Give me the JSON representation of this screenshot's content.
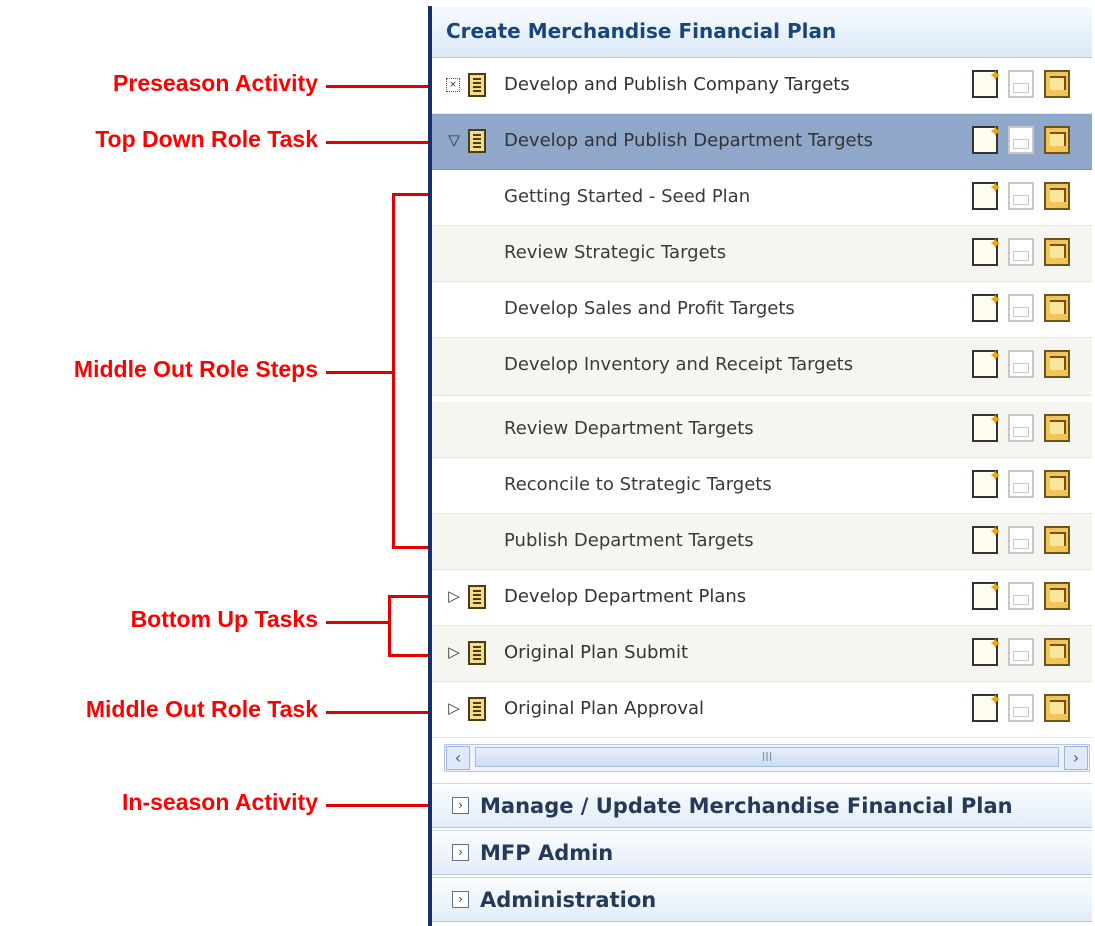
{
  "callouts": {
    "preseason": "Preseason Activity",
    "top_down": "Top Down Role Task",
    "middle_steps": "Middle Out Role Steps",
    "bottom_up": "Bottom Up Tasks",
    "middle_task": "Middle Out Role Task",
    "inseason": "In-season Activity"
  },
  "panel": {
    "title": "Create Merchandise Financial Plan",
    "tasks": [
      {
        "label": "Develop and Publish Company Targets",
        "expander": "⊠"
      },
      {
        "label": "Develop and Publish Department Targets",
        "expander": "▽"
      }
    ],
    "steps": [
      "Getting Started - Seed Plan",
      "Review Strategic Targets",
      "Develop Sales and Profit Targets",
      "Develop Inventory and Receipt Targets",
      "Review Department Targets",
      "Reconcile to Strategic Targets",
      "Publish Department Targets"
    ],
    "bottom_tasks": [
      {
        "label": "Develop Department Plans",
        "expander": "▷"
      },
      {
        "label": "Original Plan Submit",
        "expander": "▷"
      },
      {
        "label": "Original Plan Approval",
        "expander": "▷"
      }
    ],
    "scroll_thumb": "III",
    "sections": [
      {
        "label": "Manage / Update Merchandise Financial Plan"
      },
      {
        "label": "MFP Admin"
      },
      {
        "label": "Administration"
      }
    ]
  },
  "icons": {
    "expand_collapse": "chevron",
    "actions": [
      "new-icon",
      "open-icon",
      "folder-icon"
    ]
  }
}
